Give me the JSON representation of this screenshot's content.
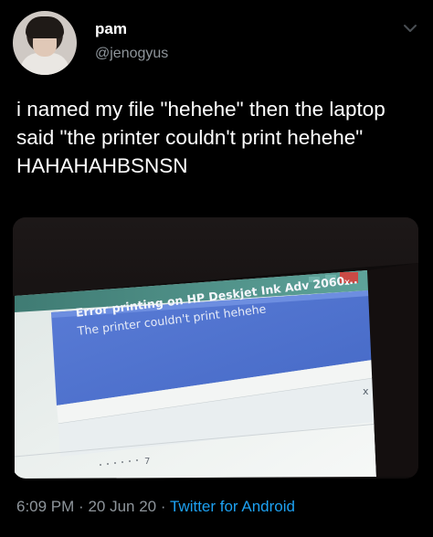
{
  "tweet": {
    "display_name": "pam",
    "handle": "@jenogyus",
    "text": "i named my file \"hehehe\" then the laptop said \"the printer couldn't print hehehe\" HAHAHAHBSNSN",
    "time": "6:09 PM",
    "date": "20 Jun 20",
    "separator": "·",
    "source": "Twitter for Android"
  },
  "photo": {
    "error_title": "Error printing on HP Deskjet Ink Adv 2060...",
    "error_message": "The printer couldn't print hehehe",
    "close_glyph": "x",
    "title_close_glyph": "x",
    "page_marker": "7"
  },
  "icons": {
    "chevron": "chevron-down-icon"
  },
  "colors": {
    "background": "#000000",
    "text": "#ffffff",
    "muted": "#8e959b",
    "link": "#1da1f2",
    "notification_blue": "#4f74cf"
  }
}
